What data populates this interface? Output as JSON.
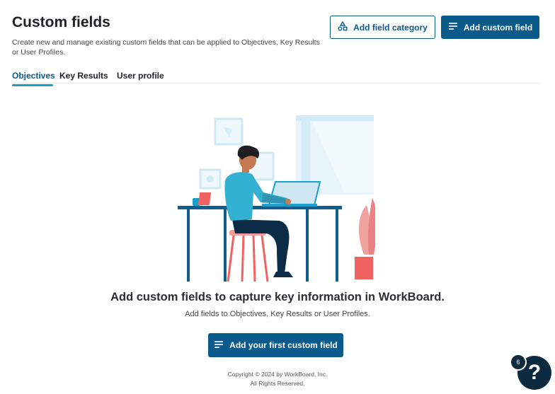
{
  "header": {
    "title": "Custom fields",
    "description": "Create new and manage existing custom fields that can be applied to Objectives, Key Results or User Profiles.",
    "add_category_label": "Add field category",
    "add_field_label": "Add custom field"
  },
  "tabs": [
    {
      "label": "Objectives",
      "active": true
    },
    {
      "label": "Key Results",
      "active": false
    },
    {
      "label": "User profile",
      "active": false
    }
  ],
  "empty_state": {
    "title": "Add custom fields to capture key information in WorkBoard.",
    "subtitle": "Add fields to Objectives, Key Results or User Profiles.",
    "button_label": "Add your first custom field"
  },
  "footer": {
    "line1": "Copyright © 2024 by WorkBoard, Inc.",
    "line2": "All Rights Reserved."
  },
  "help": {
    "badge_count": "6",
    "icon_glyph": "?"
  },
  "colors": {
    "primary": "#0a5a8c",
    "tab_accent": "#1aa0c8",
    "help_bg": "#0c2a3d"
  }
}
